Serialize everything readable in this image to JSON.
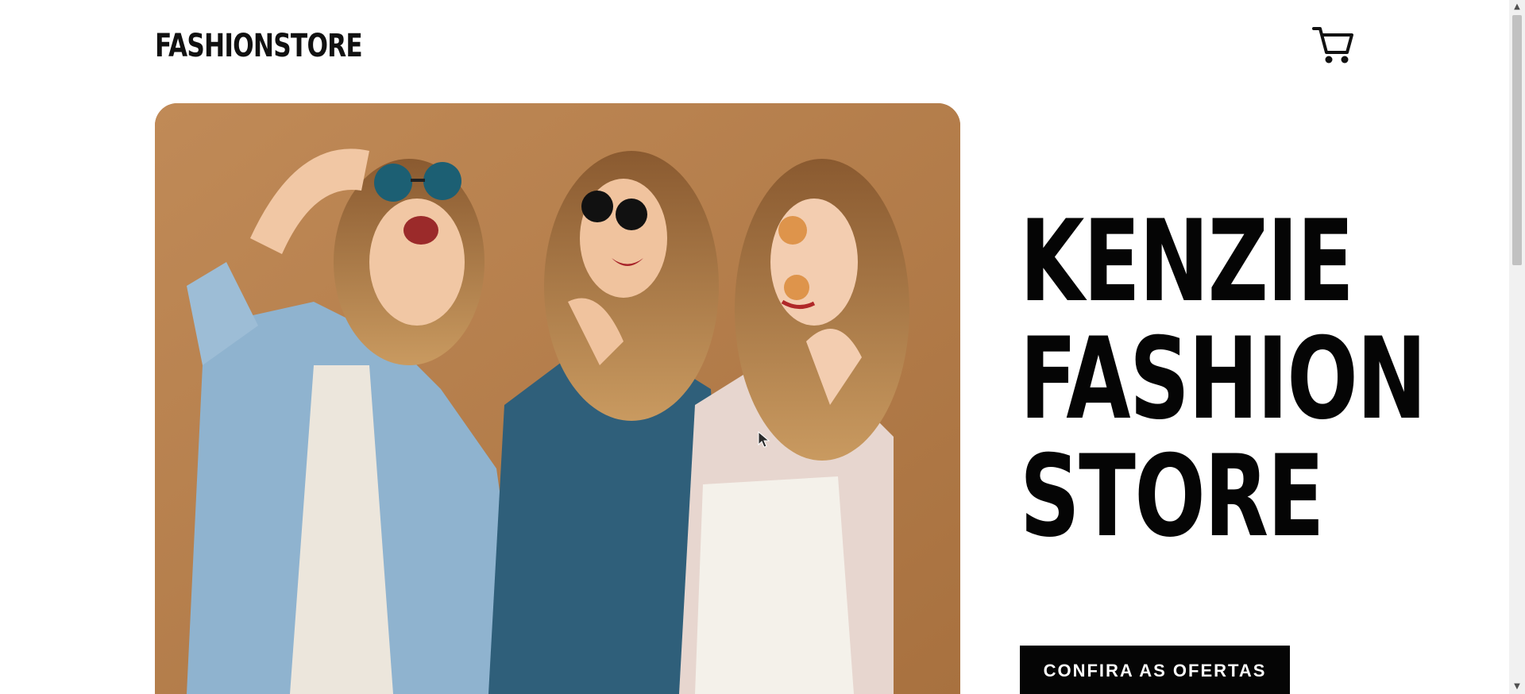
{
  "header": {
    "logo": "FASHIONSTORE",
    "cart_icon": "shopping-cart-icon"
  },
  "hero": {
    "image_description_icon": "hero-photo",
    "headline_lines": [
      "KENZIE",
      "FASHION",
      "STORE"
    ],
    "cta_label": "CONFIRA AS OFERTAS"
  },
  "colors": {
    "background": "#ffffff",
    "text": "#050505",
    "button_bg": "#050505",
    "button_text": "#ffffff",
    "photo_backdrop": "#b9814f"
  },
  "scrollbar": {
    "up_icon": "scroll-up-arrow-icon",
    "down_icon": "scroll-down-arrow-icon"
  }
}
